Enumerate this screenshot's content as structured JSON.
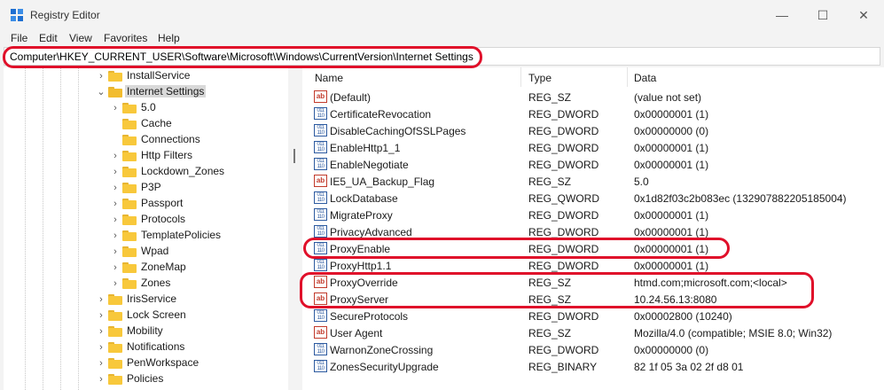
{
  "window": {
    "title": "Registry Editor",
    "minimize_glyph": "—",
    "maximize_glyph": "☐",
    "close_glyph": "✕"
  },
  "menu": [
    "File",
    "Edit",
    "View",
    "Favorites",
    "Help"
  ],
  "address": "Computer\\HKEY_CURRENT_USER\\Software\\Microsoft\\Windows\\CurrentVersion\\Internet Settings",
  "tree": [
    {
      "label": "InstallService",
      "chevron": "›",
      "icon": "folder-icon"
    },
    {
      "label": "Internet Settings",
      "chevron": "⌄",
      "icon": "folder-open-icon",
      "selected": true
    },
    {
      "label": "5.0",
      "chevron": "›",
      "icon": "folder-icon"
    },
    {
      "label": "Cache",
      "chevron": "",
      "icon": "folder-icon"
    },
    {
      "label": "Connections",
      "chevron": "",
      "icon": "folder-icon"
    },
    {
      "label": "Http Filters",
      "chevron": "›",
      "icon": "folder-icon"
    },
    {
      "label": "Lockdown_Zones",
      "chevron": "›",
      "icon": "folder-icon"
    },
    {
      "label": "P3P",
      "chevron": "›",
      "icon": "folder-icon"
    },
    {
      "label": "Passport",
      "chevron": "›",
      "icon": "folder-icon"
    },
    {
      "label": "Protocols",
      "chevron": "›",
      "icon": "folder-icon"
    },
    {
      "label": "TemplatePolicies",
      "chevron": "›",
      "icon": "folder-icon"
    },
    {
      "label": "Wpad",
      "chevron": "›",
      "icon": "folder-icon"
    },
    {
      "label": "ZoneMap",
      "chevron": "›",
      "icon": "folder-icon"
    },
    {
      "label": "Zones",
      "chevron": "›",
      "icon": "folder-icon"
    },
    {
      "label": "IrisService",
      "chevron": "›",
      "icon": "folder-icon"
    },
    {
      "label": "Lock Screen",
      "chevron": "›",
      "icon": "folder-icon"
    },
    {
      "label": "Mobility",
      "chevron": "›",
      "icon": "folder-icon"
    },
    {
      "label": "Notifications",
      "chevron": "›",
      "icon": "folder-icon"
    },
    {
      "label": "PenWorkspace",
      "chevron": "›",
      "icon": "folder-icon"
    },
    {
      "label": "Policies",
      "chevron": "›",
      "icon": "folder-icon"
    }
  ],
  "columns": {
    "name": "Name",
    "type": "Type",
    "data": "Data"
  },
  "values": [
    {
      "name": "(Default)",
      "type": "REG_SZ",
      "data": "(value not set)",
      "icon": "string-value-icon"
    },
    {
      "name": "CertificateRevocation",
      "type": "REG_DWORD",
      "data": "0x00000001 (1)",
      "icon": "binary-value-icon"
    },
    {
      "name": "DisableCachingOfSSLPages",
      "type": "REG_DWORD",
      "data": "0x00000000 (0)",
      "icon": "binary-value-icon"
    },
    {
      "name": "EnableHttp1_1",
      "type": "REG_DWORD",
      "data": "0x00000001 (1)",
      "icon": "binary-value-icon"
    },
    {
      "name": "EnableNegotiate",
      "type": "REG_DWORD",
      "data": "0x00000001 (1)",
      "icon": "binary-value-icon"
    },
    {
      "name": "IE5_UA_Backup_Flag",
      "type": "REG_SZ",
      "data": "5.0",
      "icon": "string-value-icon"
    },
    {
      "name": "LockDatabase",
      "type": "REG_QWORD",
      "data": "0x1d82f03c2b083ec (132907882205185004)",
      "icon": "binary-value-icon"
    },
    {
      "name": "MigrateProxy",
      "type": "REG_DWORD",
      "data": "0x00000001 (1)",
      "icon": "binary-value-icon"
    },
    {
      "name": "PrivacyAdvanced",
      "type": "REG_DWORD",
      "data": "0x00000001 (1)",
      "icon": "binary-value-icon"
    },
    {
      "name": "ProxyEnable",
      "type": "REG_DWORD",
      "data": "0x00000001 (1)",
      "icon": "binary-value-icon"
    },
    {
      "name": "ProxyHttp1.1",
      "type": "REG_DWORD",
      "data": "0x00000001 (1)",
      "icon": "binary-value-icon"
    },
    {
      "name": "ProxyOverride",
      "type": "REG_SZ",
      "data": "htmd.com;microsoft.com;<local>",
      "icon": "string-value-icon"
    },
    {
      "name": "ProxyServer",
      "type": "REG_SZ",
      "data": "10.24.56.13:8080",
      "icon": "string-value-icon"
    },
    {
      "name": "SecureProtocols",
      "type": "REG_DWORD",
      "data": "0x00002800 (10240)",
      "icon": "binary-value-icon"
    },
    {
      "name": "User Agent",
      "type": "REG_SZ",
      "data": "Mozilla/4.0 (compatible; MSIE 8.0; Win32)",
      "icon": "string-value-icon"
    },
    {
      "name": "WarnonZoneCrossing",
      "type": "REG_DWORD",
      "data": "0x00000000 (0)",
      "icon": "binary-value-icon"
    },
    {
      "name": "ZonesSecurityUpgrade",
      "type": "REG_BINARY",
      "data": "82 1f 05 3a 02 2f d8 01",
      "icon": "binary-value-icon"
    }
  ],
  "icon_glyphs": {
    "string": "ab",
    "binary": "011 110"
  },
  "colors": {
    "highlight": "#e0102a",
    "folder": "#f8c83b",
    "string_icon": "#c23a2b",
    "binary_icon": "#2c5aa0"
  }
}
